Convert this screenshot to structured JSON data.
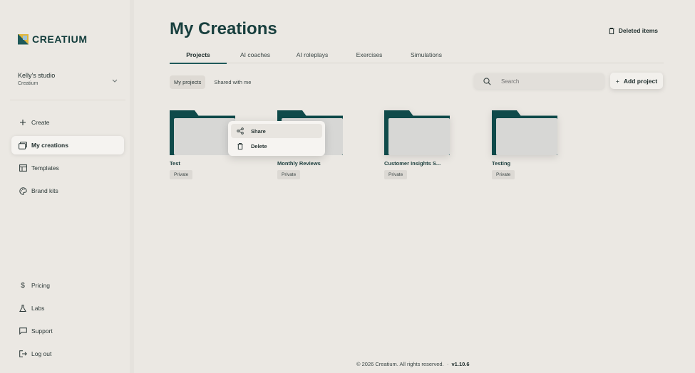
{
  "brand": {
    "name": "CREATIUM"
  },
  "studio": {
    "name": "Kelly's studio",
    "org": "Creatium"
  },
  "nav": {
    "create": "Create",
    "my_creations": "My creations",
    "templates": "Templates",
    "brand_kits": "Brand kits",
    "pricing": "Pricing",
    "labs": "Labs",
    "support": "Support",
    "logout": "Log out"
  },
  "page": {
    "title": "My Creations",
    "deleted_items": "Deleted items"
  },
  "tabs": [
    "Projects",
    "AI coaches",
    "AI roleplays",
    "Exercises",
    "Simulations"
  ],
  "subtabs": [
    "My projects",
    "Shared with me"
  ],
  "search": {
    "placeholder": "Search"
  },
  "actions": {
    "add_project": "Add project"
  },
  "projects": [
    {
      "name": "Test",
      "visibility": "Private"
    },
    {
      "name": "Monthly Reviews",
      "visibility": "Private"
    },
    {
      "name": "Customer Insights S...",
      "visibility": "Private"
    },
    {
      "name": "Testing",
      "visibility": "Private"
    }
  ],
  "context_menu": {
    "share": "Share",
    "delete": "Delete"
  },
  "footer": {
    "copyright": "© 2026 Creatium. All rights reserved.",
    "separator": "·",
    "version": "v1.10.6"
  },
  "colors": {
    "accent": "#0f4a4a",
    "background": "#ebe8e3"
  }
}
